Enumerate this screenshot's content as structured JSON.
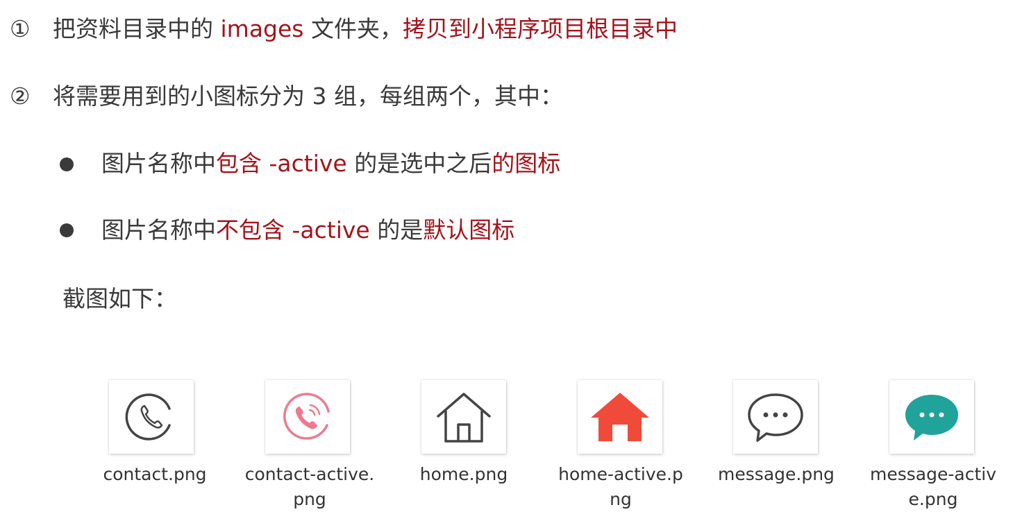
{
  "steps": [
    {
      "marker": "①",
      "segments": [
        {
          "text": "把资料目录中的 ",
          "red": false
        },
        {
          "text": "images",
          "red": true
        },
        {
          "text": " 文件夹，",
          "red": false
        },
        {
          "text": "拷贝到小程序项目根目录中",
          "red": true
        }
      ]
    },
    {
      "marker": "②",
      "segments": [
        {
          "text": "将需要用到的小图标分为 3 组，每组两个，其中：",
          "red": false
        }
      ]
    }
  ],
  "bullets": [
    {
      "segments": [
        {
          "text": "图片名称中",
          "red": false
        },
        {
          "text": "包含 -active",
          "red": true
        },
        {
          "text": " 的是选中之后",
          "red": false
        },
        {
          "text": "的图标",
          "red": true
        }
      ]
    },
    {
      "segments": [
        {
          "text": "图片名称中",
          "red": false
        },
        {
          "text": "不包含 -active",
          "red": true
        },
        {
          "text": " 的是",
          "red": false
        },
        {
          "text": "默认图标",
          "red": true
        }
      ]
    }
  ],
  "screenshot_label": "截图如下：",
  "files": [
    {
      "name": "contact.png",
      "icon": "phone-outline-icon"
    },
    {
      "name": "contact-active.png",
      "icon": "phone-active-icon"
    },
    {
      "name": "home.png",
      "icon": "home-outline-icon"
    },
    {
      "name": "home-active.png",
      "icon": "home-filled-icon"
    },
    {
      "name": "message.png",
      "icon": "message-outline-icon"
    },
    {
      "name": "message-active.png",
      "icon": "message-filled-icon"
    }
  ],
  "colors": {
    "text": "#3a3a3a",
    "highlight": "#a3141c",
    "contact_active": "#ee7a8f",
    "home_active": "#f04b3a",
    "message_active": "#1fa39a",
    "outline_icon": "#444444"
  }
}
